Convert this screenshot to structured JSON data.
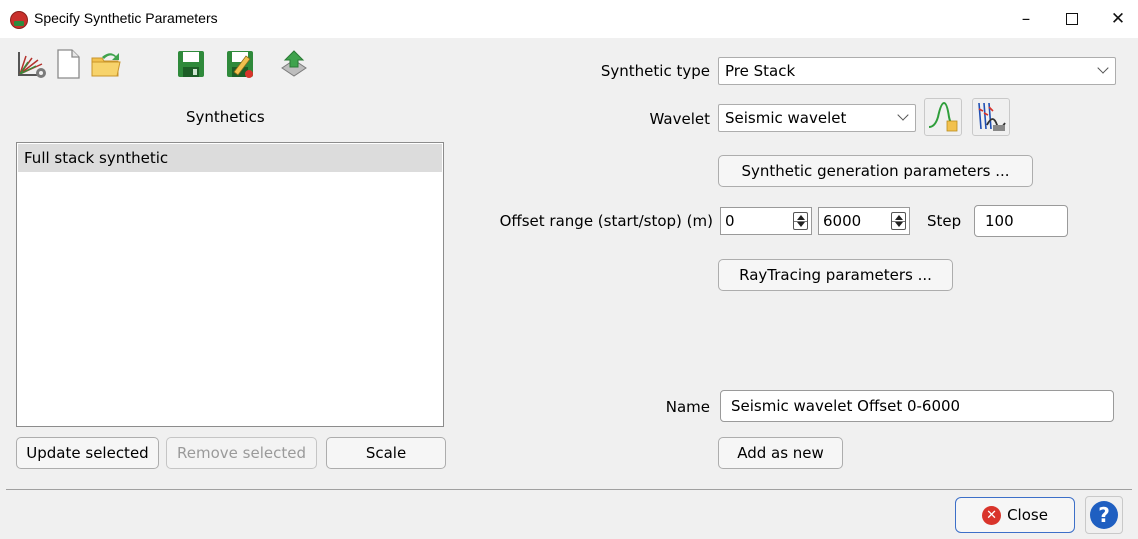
{
  "window": {
    "title": "Specify Synthetic Parameters",
    "icon": "app-logo-icon",
    "minimize_glyph": "–",
    "close_glyph": "✕"
  },
  "toolbar": {
    "buttons": [
      {
        "icon": "synthetic-generate-icon"
      },
      {
        "icon": "new-document-icon"
      },
      {
        "icon": "open-folder-icon"
      },
      {
        "icon": "save-disk-icon"
      },
      {
        "icon": "save-as-disk-icon"
      },
      {
        "icon": "export-green-arrow-icon"
      }
    ]
  },
  "synthetics": {
    "heading": "Synthetics",
    "items": [
      "Full stack synthetic"
    ],
    "selected_index": 0
  },
  "list_buttons": {
    "update": "Update selected",
    "remove": "Remove selected",
    "scale": "Scale"
  },
  "form": {
    "synthetic_type_label": "Synthetic type",
    "synthetic_type_value": "Pre Stack",
    "wavelet_label": "Wavelet",
    "wavelet_value": "Seismic wavelet",
    "wavelet_icons": [
      "wavelet-editor-icon",
      "wavelet-extraction-icon"
    ],
    "synthetic_generation_button": "Synthetic generation parameters ...",
    "offset_range_label": "Offset range (start/stop) (m)",
    "offset_start": "0",
    "offset_stop": "6000",
    "step_label": "Step",
    "step_value": "100",
    "raytracing_button": "RayTracing parameters ...",
    "name_label": "Name",
    "name_value": "Seismic wavelet Offset 0-6000",
    "add_as_new_button": "Add as new"
  },
  "footer": {
    "close_label": "Close",
    "close_icon": "close-circle-icon",
    "help_icon": "help-question-icon",
    "help_glyph": "?"
  },
  "colors": {
    "background": "#f0f0f0",
    "selection": "#dcdcdc",
    "accent_border": "#3c6fc8",
    "close_red": "#d9342b",
    "help_blue": "#1f5fc1"
  }
}
